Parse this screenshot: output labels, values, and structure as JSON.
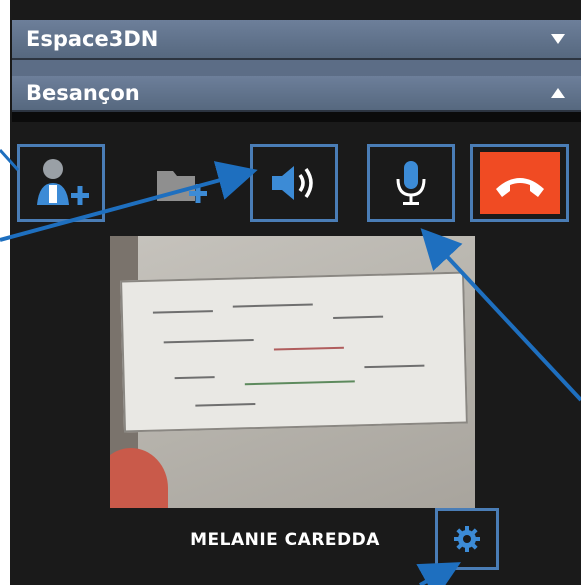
{
  "sections": [
    {
      "title": "Espace3DN"
    },
    {
      "title": "Besançon"
    }
  ],
  "toolbar": [
    {
      "name": "add-participant-button",
      "icon": "add-user-icon"
    },
    {
      "name": "add-file-button",
      "icon": "add-folder-icon"
    },
    {
      "name": "speaker-button",
      "icon": "speaker-icon"
    },
    {
      "name": "microphone-button",
      "icon": "microphone-icon"
    },
    {
      "name": "hangup-button",
      "icon": "phone-hangup-icon"
    }
  ],
  "video": {
    "participant_name": "MELANIE CAREDDA"
  },
  "colors": {
    "header": "#5f7290",
    "panel": "#1a1a1a",
    "accent": "#4a9fe0",
    "highlight_border": "#4a7db6",
    "hangup": "#f04b23"
  }
}
